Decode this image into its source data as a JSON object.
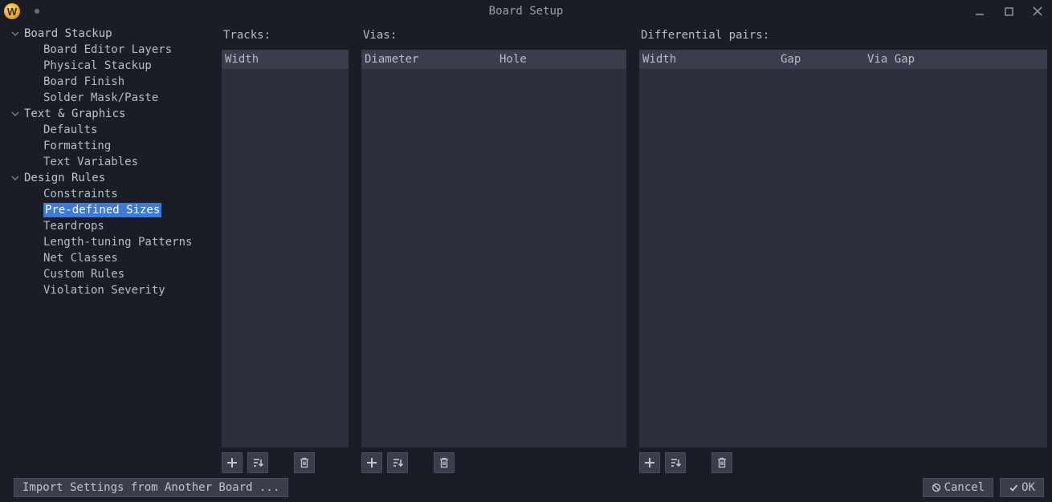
{
  "window": {
    "title": "Board Setup",
    "app_initial": "W"
  },
  "sidebar": {
    "groups": [
      {
        "label": "Board Stackup",
        "items": [
          "Board Editor Layers",
          "Physical Stackup",
          "Board Finish",
          "Solder Mask/Paste"
        ]
      },
      {
        "label": "Text & Graphics",
        "items": [
          "Defaults",
          "Formatting",
          "Text Variables"
        ]
      },
      {
        "label": "Design Rules",
        "items": [
          "Constraints",
          "Pre-defined Sizes",
          "Teardrops",
          "Length-tuning Patterns",
          "Net Classes",
          "Custom Rules",
          "Violation Severity"
        ]
      }
    ],
    "selected": "Pre-defined Sizes"
  },
  "columns": {
    "tracks": {
      "title": "Tracks:",
      "headers": [
        "Width"
      ]
    },
    "vias": {
      "title": "Vias:",
      "headers": [
        "Diameter",
        "Hole"
      ]
    },
    "diff": {
      "title": "Differential pairs:",
      "headers": [
        "Width",
        "Gap",
        "Via Gap"
      ]
    }
  },
  "footer": {
    "import_label": "Import Settings from Another Board ...",
    "cancel_label": "Cancel",
    "ok_label": "OK"
  }
}
